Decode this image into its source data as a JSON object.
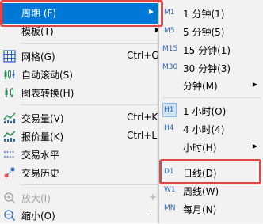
{
  "left_menu": {
    "period": {
      "label": "周期 (F)"
    },
    "template": {
      "label": "模板(T)"
    },
    "grid": {
      "label": "网格(G)",
      "shortcut": "Ctrl+G"
    },
    "auto_scroll": {
      "label": "自动滚动(S)"
    },
    "chart_switch": {
      "label": "图表转换(H)"
    },
    "volume": {
      "label": "交易量(V)",
      "shortcut": "Ctrl+K"
    },
    "tick_volume": {
      "label": "报价量(K)",
      "shortcut": "Ctrl+L"
    },
    "trade_levels": {
      "label": "交易水平"
    },
    "trade_history": {
      "label": "交易历史"
    },
    "zoom_in": {
      "label": "放大(I)",
      "shortcut": "+"
    },
    "zoom_out": {
      "label": "缩小(O)",
      "shortcut": "-"
    }
  },
  "period_submenu": {
    "items": [
      {
        "code": "M1",
        "label": "1 分钟(1)"
      },
      {
        "code": "M5",
        "label": "5 分钟(5)"
      },
      {
        "code": "M15",
        "label": "15 分钟(1)"
      },
      {
        "code": "M30",
        "label": "30 分钟(3)"
      },
      {
        "code": "",
        "label": "分钟(M)"
      },
      {
        "code": "H1",
        "label": "1 小时(O)"
      },
      {
        "code": "H4",
        "label": "4 小时(4)"
      },
      {
        "code": "",
        "label": "小时(H)"
      },
      {
        "code": "D1",
        "label": "日线(D)"
      },
      {
        "code": "W1",
        "label": "周线(W)"
      },
      {
        "code": "MN",
        "label": "每月(N)"
      }
    ]
  },
  "colors": {
    "highlight": "#0078d7",
    "annotation_box": "#e04646",
    "icon_accent": "#2b64b8"
  }
}
